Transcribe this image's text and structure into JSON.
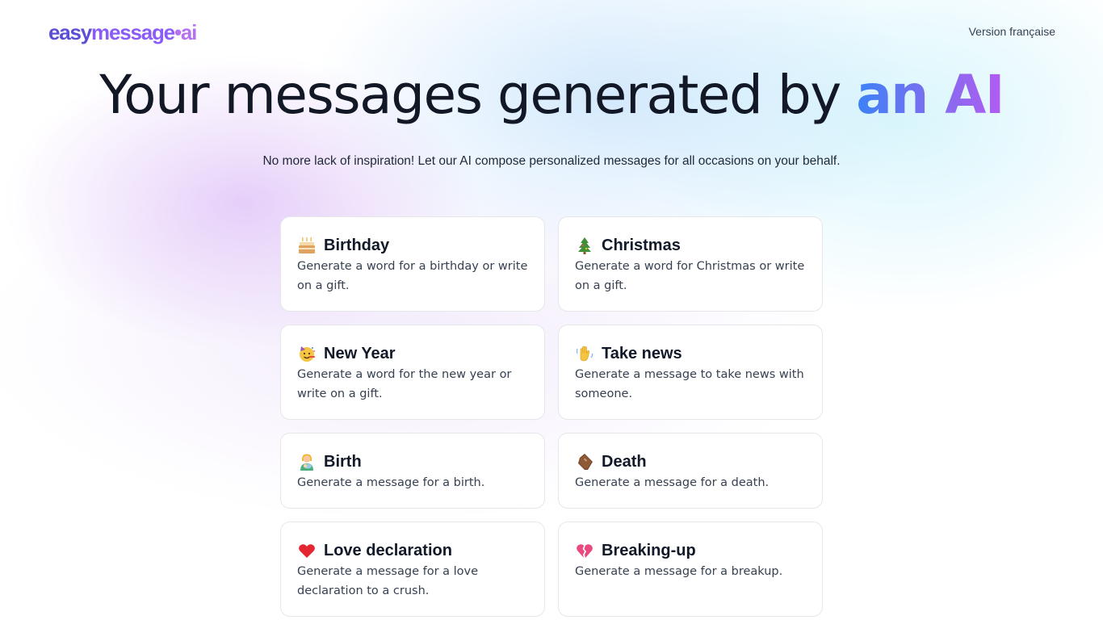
{
  "header": {
    "logo": {
      "part1": "easy",
      "part2": "message",
      "part3": "•ai"
    },
    "language_link": "Version française"
  },
  "hero": {
    "title_main": "Your messages generated by ",
    "title_accent": "an AI",
    "subtitle": "No more lack of inspiration! Let our AI compose personalized messages for all occasions on your behalf."
  },
  "cards": [
    {
      "icon": "cake-icon",
      "title": "Birthday",
      "description": "Generate a word for a birthday or write on a gift."
    },
    {
      "icon": "christmas-tree-icon",
      "title": "Christmas",
      "description": "Generate a word for Christmas or write on a gift."
    },
    {
      "icon": "party-face-icon",
      "title": "New Year",
      "description": "Generate a word for the new year or write on a gift."
    },
    {
      "icon": "waving-hand-icon",
      "title": "Take news",
      "description": "Generate a message to take news with someone."
    },
    {
      "icon": "person-with-baby-icon",
      "title": "Birth",
      "description": "Generate a message for a birth."
    },
    {
      "icon": "coffin-icon",
      "title": "Death",
      "description": "Generate a message for a death."
    },
    {
      "icon": "red-heart-icon",
      "title": "Love declaration",
      "description": "Generate a message for a love declaration to a crush."
    },
    {
      "icon": "broken-heart-icon",
      "title": "Breaking-up",
      "description": "Generate a message for a breakup."
    }
  ],
  "colors": {
    "accent_blue": "#3b82f6",
    "accent_purple": "#b25cf1",
    "logo_dark": "#5b4fd6",
    "logo_light": "#b472f0"
  }
}
